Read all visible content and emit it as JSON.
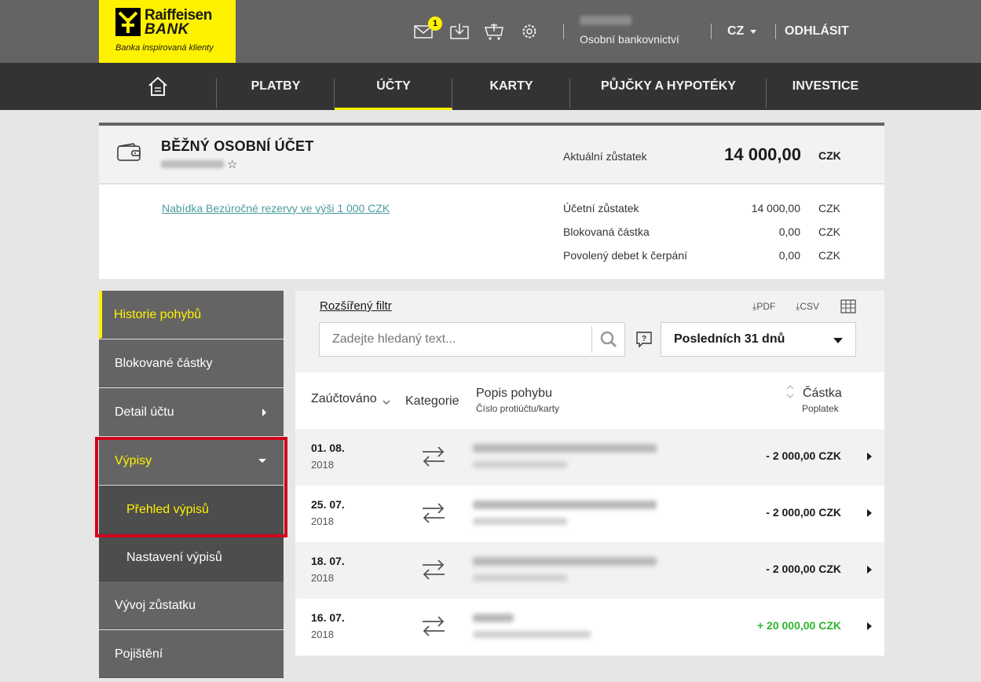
{
  "brand": {
    "name_line1": "Raiffeisen",
    "name_line2": "BANK",
    "tagline": "Banka inspirovaná klienty",
    "color": "#fff200"
  },
  "header": {
    "messages_badge": "1",
    "icons": [
      "envelope-icon",
      "download-box-icon",
      "cart-gift-icon",
      "gear-icon"
    ],
    "user_subtitle": "Osobní bankovnictví",
    "language": "CZ",
    "logout": "ODHLÁSIT"
  },
  "nav": {
    "items": [
      {
        "label": "PLATBY"
      },
      {
        "label": "ÚČTY",
        "active": true
      },
      {
        "label": "KARTY"
      },
      {
        "label": "PŮJČKY A HYPOTÉKY"
      },
      {
        "label": "INVESTICE"
      }
    ]
  },
  "account": {
    "title": "BĚŽNÝ OSOBNÍ ÚČET",
    "favorite_symbol": "☆",
    "current_balance_label": "Aktuální zůstatek",
    "current_balance": "14 000,00",
    "currency": "CZK",
    "offer_link": "Nabídka Bezúročné rezervy ve výši 1 000 CZK",
    "details": [
      {
        "label": "Účetní zůstatek",
        "value": "14 000,00",
        "currency": "CZK"
      },
      {
        "label": "Blokovaná částka",
        "value": "0,00",
        "currency": "CZK"
      },
      {
        "label": "Povolený debet k čerpání",
        "value": "0,00",
        "currency": "CZK"
      }
    ]
  },
  "sidebar": {
    "items": [
      {
        "label": "Historie pohybů"
      },
      {
        "label": "Blokované částky"
      },
      {
        "label": "Detail účtu"
      },
      {
        "label": "Výpisy"
      },
      {
        "label": "Přehled výpisů"
      },
      {
        "label": "Nastavení výpisů"
      },
      {
        "label": "Vývoj zůstatku"
      },
      {
        "label": "Pojištění"
      }
    ]
  },
  "filters": {
    "advanced_filter": "Rozšířený filtr",
    "pdf": "PDF",
    "csv": "CSV",
    "search_placeholder": "Zadejte hledaný text...",
    "period": "Posledních 31 dnů"
  },
  "table": {
    "col_booked": "Zaúčtováno",
    "col_category": "Kategorie",
    "col_description": "Popis pohybu",
    "col_description_sub": "Číslo protiúčtu/karty",
    "col_amount": "Částka",
    "col_amount_sub": "Poplatek",
    "rows": [
      {
        "date": "01. 08.",
        "year": "2018",
        "amount": "- 2 000,00 CZK"
      },
      {
        "date": "25. 07.",
        "year": "2018",
        "amount": "- 2 000,00 CZK"
      },
      {
        "date": "18. 07.",
        "year": "2018",
        "amount": "- 2 000,00 CZK"
      },
      {
        "date": "16. 07.",
        "year": "2018",
        "amount": "+ 20 000,00 CZK"
      }
    ]
  }
}
